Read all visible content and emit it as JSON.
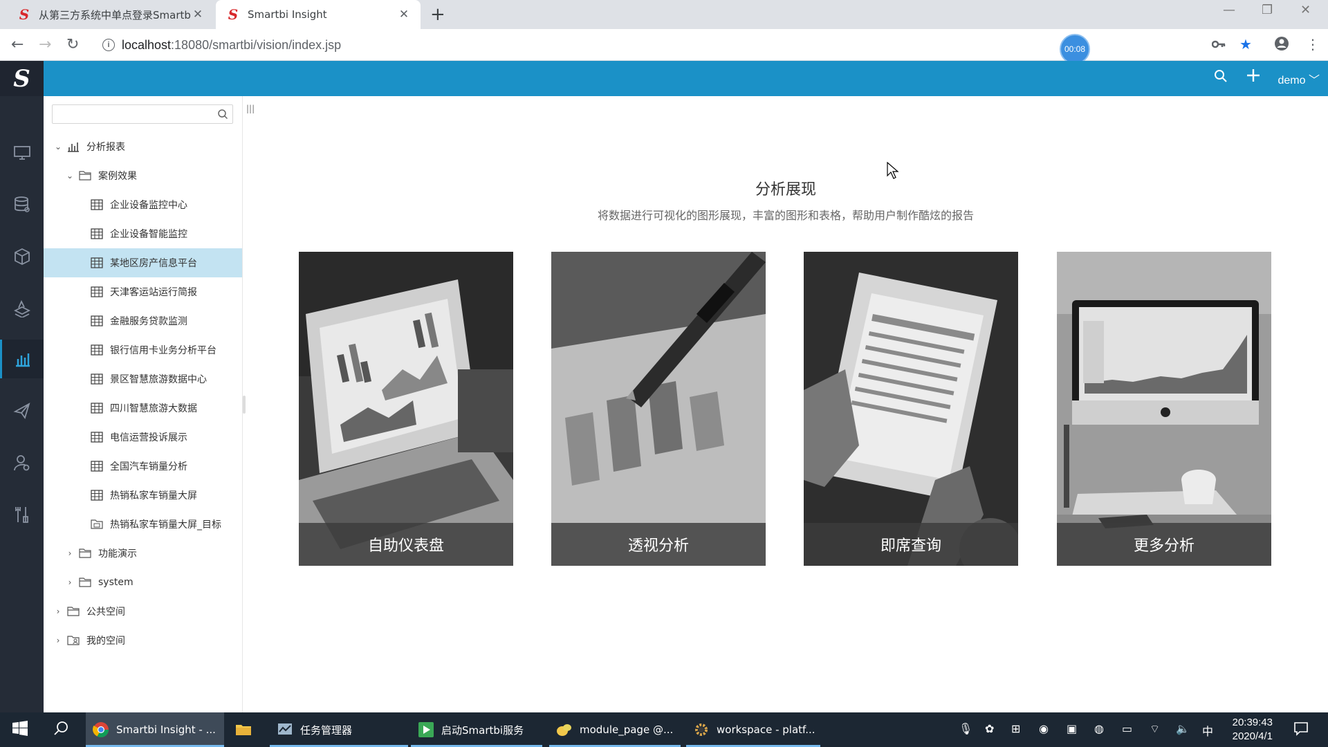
{
  "browser": {
    "tabs": [
      {
        "title": "从第三方系统中单点登录Smartbi",
        "close": "✕"
      },
      {
        "title": "Smartbi Insight",
        "close": "✕"
      }
    ],
    "new_tab": "+",
    "url_host": "localhost",
    "url_path": ":18080/smartbi/vision/index.jsp",
    "timer": "00:08"
  },
  "header": {
    "user": "demo"
  },
  "tree": {
    "search_placeholder": "",
    "items": [
      {
        "label": "分析报表",
        "level": 0,
        "caret": "open",
        "icon": "chart-icon"
      },
      {
        "label": "案例效果",
        "level": 1,
        "caret": "open",
        "icon": "folder-icon"
      },
      {
        "label": "企业设备监控中心",
        "level": 2,
        "icon": "grid-icon"
      },
      {
        "label": "企业设备智能监控",
        "level": 2,
        "icon": "grid-icon"
      },
      {
        "label": "某地区房产信息平台",
        "level": 2,
        "icon": "grid-icon",
        "selected": true
      },
      {
        "label": "天津客运站运行简报",
        "level": 2,
        "icon": "grid-icon"
      },
      {
        "label": "金融服务贷款监测",
        "level": 2,
        "icon": "grid-icon"
      },
      {
        "label": "银行信用卡业务分析平台",
        "level": 2,
        "icon": "grid-icon"
      },
      {
        "label": "景区智慧旅游数据中心",
        "level": 2,
        "icon": "grid-icon"
      },
      {
        "label": "四川智慧旅游大数据",
        "level": 2,
        "icon": "grid-icon"
      },
      {
        "label": "电信运营投诉展示",
        "level": 2,
        "icon": "grid-icon"
      },
      {
        "label": "全国汽车销量分析",
        "level": 2,
        "icon": "grid-icon"
      },
      {
        "label": "热销私家车销量大屏",
        "level": 2,
        "icon": "grid-icon"
      },
      {
        "label": "热销私家车销量大屏_目标",
        "level": 2,
        "icon": "doc-folder-icon"
      },
      {
        "label": "功能演示",
        "level": 1,
        "caret": "closed",
        "icon": "folder-icon"
      },
      {
        "label": "system",
        "level": 1,
        "caret": "closed",
        "icon": "folder-icon"
      },
      {
        "label": "公共空间",
        "level": 0,
        "caret": "closed",
        "icon": "folder-icon"
      },
      {
        "label": "我的空间",
        "level": 0,
        "caret": "closed",
        "icon": "user-folder-icon"
      }
    ]
  },
  "main": {
    "title": "分析展现",
    "subtitle": "将数据进行可视化的图形展现，丰富的图形和表格，帮助用户制作酷炫的报告",
    "cards": [
      {
        "label": "自助仪表盘"
      },
      {
        "label": "透视分析"
      },
      {
        "label": "即席查询"
      },
      {
        "label": "更多分析"
      }
    ]
  },
  "taskbar": {
    "items": [
      {
        "label": "Smartbi Insight - ..."
      },
      {
        "label": "任务管理器"
      },
      {
        "label": "启动Smartbi服务"
      },
      {
        "label": "module_page @..."
      },
      {
        "label": "workspace - platf..."
      }
    ],
    "ime": "中",
    "time": "20:39:43",
    "date": "2020/4/1"
  },
  "colors": {
    "header": "#1b91c7",
    "iconbar": "#252c37",
    "selected_row": "#c3e3f2"
  }
}
